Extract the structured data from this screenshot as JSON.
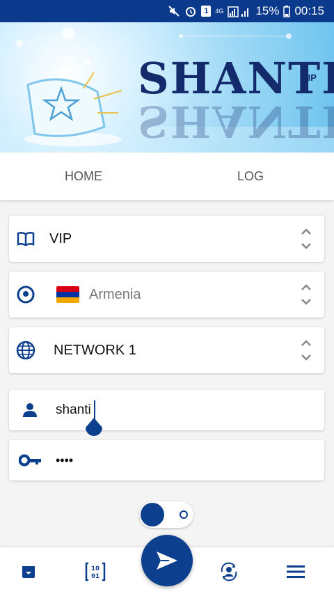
{
  "status_bar": {
    "battery": "15%",
    "time": "00:15",
    "network": "4G",
    "sim": "1"
  },
  "banner": {
    "brand": "SHANTI",
    "badge": "VIP"
  },
  "tabs": [
    {
      "label": "HOME"
    },
    {
      "label": "LOG"
    }
  ],
  "form": {
    "plan": {
      "value": "VIP"
    },
    "country": {
      "value": "Armenia"
    },
    "network": {
      "value": "NETWORK 1"
    },
    "username": {
      "value": "shanti"
    },
    "password": {
      "value": "••••"
    }
  },
  "toggle": {
    "state": "on"
  },
  "colors": {
    "primary": "#0d3f8f",
    "status_bar": "#0b3a8c"
  },
  "bottom_nav": [
    {
      "icon": "archive-icon"
    },
    {
      "icon": "binary-icon"
    },
    {
      "icon": "send-icon"
    },
    {
      "icon": "account-sync-icon"
    },
    {
      "icon": "menu-icon"
    }
  ]
}
